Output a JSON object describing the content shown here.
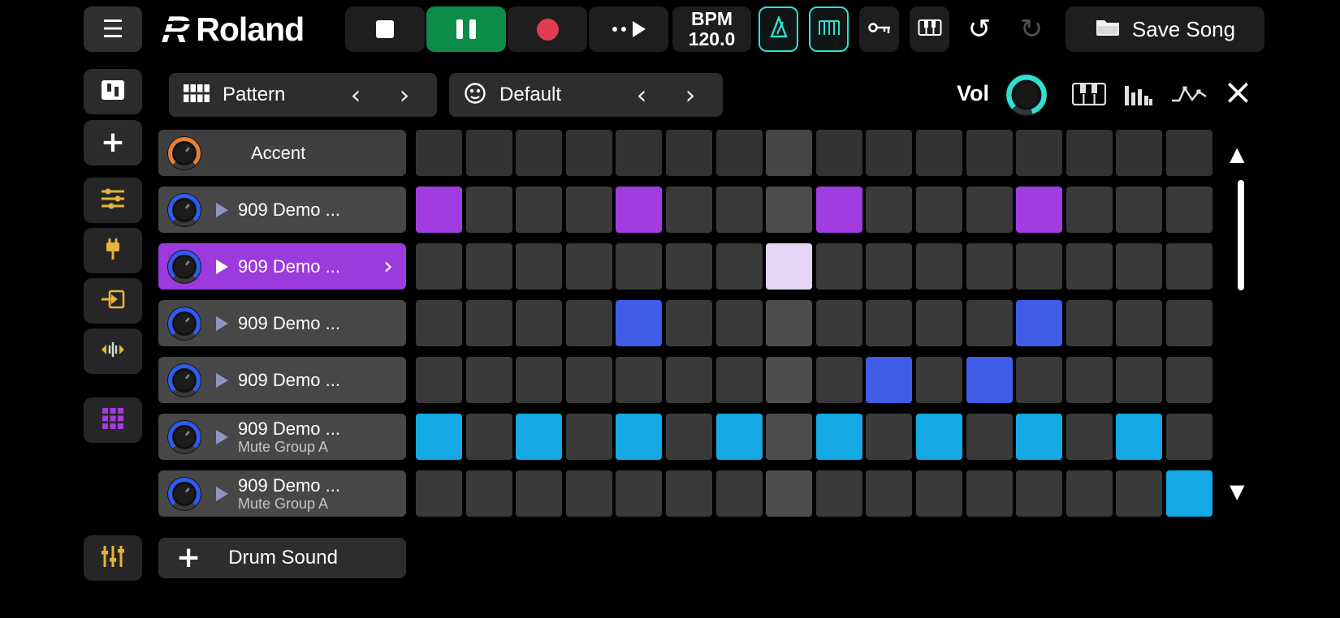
{
  "header": {
    "brand": "Roland",
    "bpm_label": "BPM",
    "bpm_value": "120.0",
    "save_label": "Save Song"
  },
  "panel": {
    "pattern_label": "Pattern",
    "kit_label": "Default",
    "vol_label": "Vol"
  },
  "footer": {
    "add_drum_label": "Drum Sound"
  },
  "icons": {
    "menu": "☰",
    "logo_mark": "R",
    "plus": "+",
    "undo": "↺",
    "redo": "↻",
    "chevron_left": "‹",
    "chevron_right": "›",
    "close": "×",
    "scroll_up": "▲",
    "scroll_down": "▼"
  },
  "colors": {
    "step_purple": "#a13ce0",
    "step_blue": "#3f5de8",
    "step_cyan": "#14a8e4",
    "step_lightpurple": "#e6d4f4",
    "step_inactive": "#3a3a3a",
    "step_inactive_accent": "#333333",
    "step_playhead": "#4d4d4d",
    "selected_row": "#9b3add",
    "pause_green": "#0c8c49",
    "record_red": "#e23b53",
    "teal": "#2fe0d1",
    "gold": "#e6b33c",
    "sidebar_purple": "#a43ce0",
    "play_muted": "#8f95c0"
  },
  "grid": {
    "columns": 16,
    "playhead_col": 8
  },
  "tracks": [
    {
      "label": "Accent",
      "type": "accent",
      "knob_color": "#e0813a",
      "steps": []
    },
    {
      "label": "909 Demo ...",
      "knob_color": "#2e5bf0",
      "steps": [
        {
          "col": 1,
          "color": "purple"
        },
        {
          "col": 5,
          "color": "purple"
        },
        {
          "col": 9,
          "color": "purple"
        },
        {
          "col": 13,
          "color": "purple"
        }
      ]
    },
    {
      "label": "909 Demo ...",
      "knob_color": "#2e5bf0",
      "selected": true,
      "steps": [
        {
          "col": 8,
          "color": "lightpurple"
        }
      ]
    },
    {
      "label": "909 Demo ...",
      "knob_color": "#2e5bf0",
      "steps": [
        {
          "col": 5,
          "color": "blue"
        },
        {
          "col": 13,
          "color": "blue"
        }
      ]
    },
    {
      "label": "909 Demo ...",
      "knob_color": "#2e5bf0",
      "steps": [
        {
          "col": 10,
          "color": "blue"
        },
        {
          "col": 12,
          "color": "blue"
        }
      ]
    },
    {
      "label": "909 Demo ...",
      "sublabel": "Mute Group A",
      "knob_color": "#2e5bf0",
      "steps": [
        {
          "col": 1,
          "color": "cyan"
        },
        {
          "col": 3,
          "color": "cyan"
        },
        {
          "col": 5,
          "color": "cyan"
        },
        {
          "col": 7,
          "color": "cyan"
        },
        {
          "col": 9,
          "color": "cyan"
        },
        {
          "col": 11,
          "color": "cyan"
        },
        {
          "col": 13,
          "color": "cyan"
        },
        {
          "col": 15,
          "color": "cyan"
        }
      ]
    },
    {
      "label": "909 Demo ...",
      "sublabel": "Mute Group A",
      "knob_color": "#2e5bf0",
      "steps": [
        {
          "col": 16,
          "color": "cyan"
        }
      ]
    }
  ]
}
